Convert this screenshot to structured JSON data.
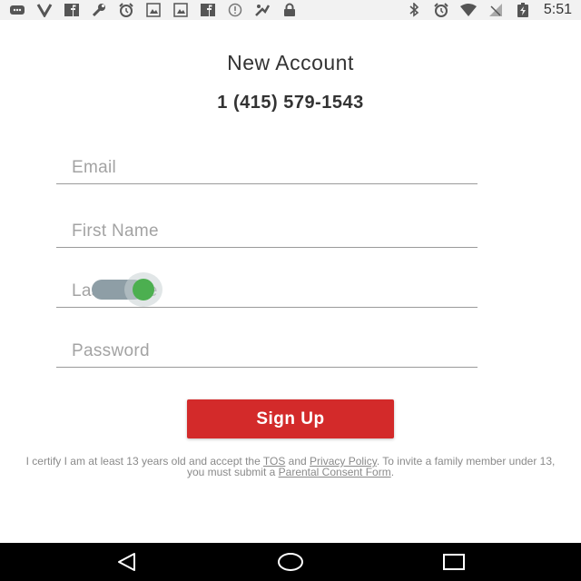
{
  "status_bar": {
    "time": "5:51",
    "left_icons": [
      "message-icon",
      "v-icon",
      "facebook-icon",
      "wrench-icon",
      "alarm-icon",
      "image-icon",
      "image-icon",
      "facebook-icon",
      "info-icon",
      "sensor-icon",
      "lock-icon"
    ],
    "right_icons": [
      "bluetooth-icon",
      "alarm-icon",
      "wifi-icon",
      "signal-icon",
      "battery-icon"
    ]
  },
  "header": {
    "title": "New Account",
    "phone": "1 (415) 579-1543"
  },
  "form": {
    "email": {
      "placeholder": "Email",
      "value": ""
    },
    "first_name": {
      "placeholder": "First Name",
      "value": ""
    },
    "last_name": {
      "placeholder": "Last Name",
      "value": ""
    },
    "password": {
      "placeholder": "Password",
      "value": ""
    },
    "toggle": {
      "on": true,
      "track_color": "#8e9ea6",
      "thumb_color": "#4caf50"
    }
  },
  "signup_button": {
    "label": "Sign Up",
    "color": "#d32a2a"
  },
  "legal": {
    "text1": "I certify I am at least 13 years old and accept the ",
    "tos_link": "TOS",
    "and": " and ",
    "privacy_link": "Privacy Policy",
    "text2": ". To invite a family member under 13, you must submit a ",
    "consent_link": "Parental Consent Form",
    "end": "."
  },
  "nav_bar": {
    "back": "back-icon",
    "home": "home-icon",
    "recents": "recents-icon"
  }
}
